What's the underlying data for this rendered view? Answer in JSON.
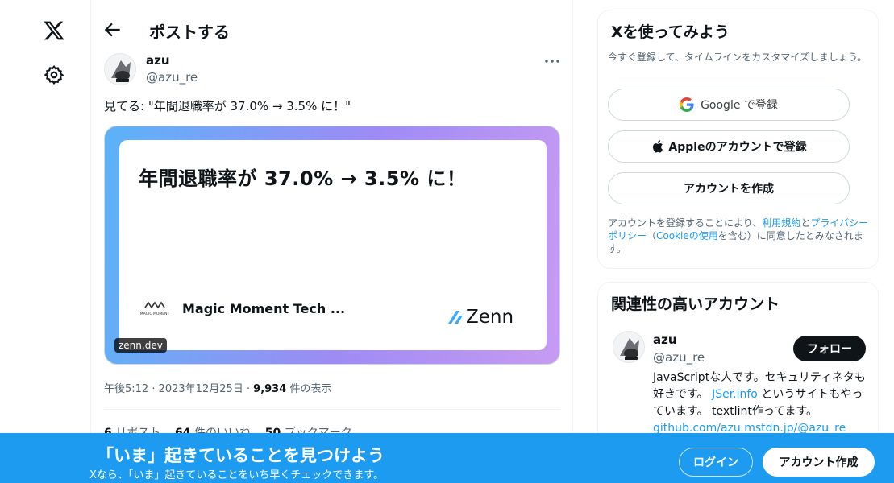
{
  "nav": {
    "logo_icon": "x-logo-icon",
    "settings_icon": "gear-icon"
  },
  "header": {
    "title": "ポストする"
  },
  "post": {
    "author_name": "azu",
    "author_handle": "@azu_re",
    "text": "見てる: \"年間退職率が 37.0% → 3.5% に！\"",
    "card": {
      "title": "年間退職率が 37.0% → 3.5% に！",
      "logo_text": "MAGIC MOMENT",
      "publisher": "Magic Moment Tech ...",
      "zenn_logo": "Zenn",
      "domain": "zenn.dev"
    },
    "time": "午後5:12 · 2023年12月25日 · ",
    "views_count": "9,934",
    "views_label": " 件の表示",
    "reposts_count": "6",
    "reposts_label": " リポスト",
    "likes_count": "64",
    "likes_label": " 件のいいね",
    "bookmarks_count": "50",
    "bookmarks_label": " ブックマーク"
  },
  "signup_panel": {
    "title": "Xを使ってみよう",
    "subtitle": "今すぐ登録して、タイムラインをカスタマイズしましょう。",
    "google_btn": "Google で登録",
    "apple_btn": "Appleのアカウントで登録",
    "create_btn": "アカウントを作成",
    "terms_1": "アカウントを登録することにより、",
    "terms_link1": "利用規約",
    "terms_2": "と",
    "terms_link2": "プライバシーポリシー",
    "terms_3": "（",
    "terms_link3": "Cookieの使用",
    "terms_4": "を含む）に同意したとみなされます。"
  },
  "related_panel": {
    "title": "関連性の高いアカウント",
    "name": "azu",
    "handle": "@azu_re",
    "follow_btn": "フォロー",
    "bio_1": "JavaScriptな人です。セキュリティネタも好きです。 ",
    "bio_link1": "JSer.info",
    "bio_2": " というサイトもやっています。 textlint作ってます。 ",
    "bio_link2": "github.com/azu",
    "bio_link3": "mstdn.jp/@azu_re"
  },
  "banner": {
    "title": "「いま」起きていることを見つけよう",
    "subtitle": "Xなら、「いま」起きていることをいち早くチェックできます。",
    "login_btn": "ログイン",
    "signup_btn": "アカウント作成"
  },
  "colors": {
    "accent": "#1d9bf0",
    "text": "#0f1419",
    "muted": "#536471"
  }
}
